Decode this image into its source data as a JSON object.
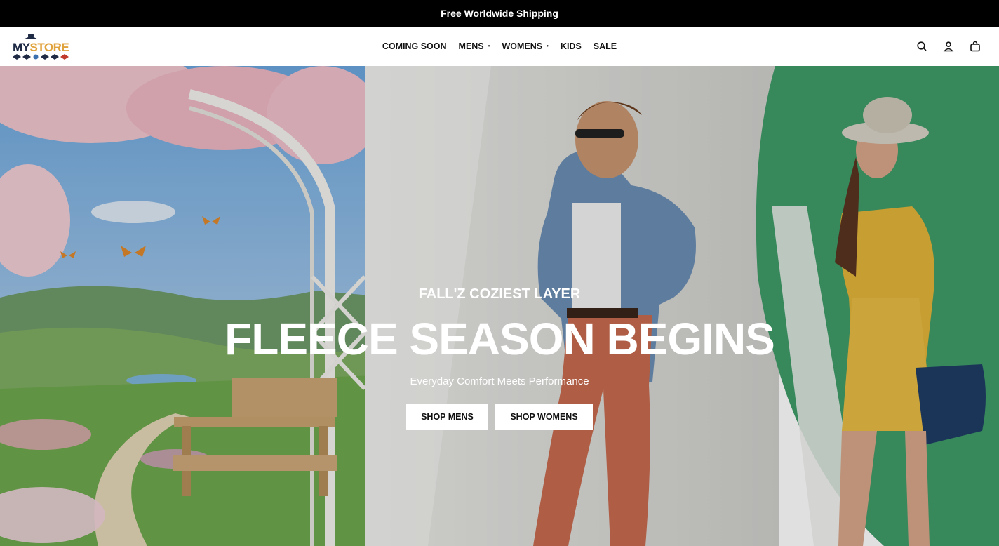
{
  "announcement": "Free Worldwide Shipping",
  "logo": {
    "part1": "MY",
    "part2": "STORE"
  },
  "nav": {
    "items": [
      {
        "label": "COMING SOON",
        "dropdown": false
      },
      {
        "label": "MENS",
        "dropdown": true
      },
      {
        "label": "WOMENS",
        "dropdown": true
      },
      {
        "label": "KIDS",
        "dropdown": false
      },
      {
        "label": "SALE",
        "dropdown": false
      }
    ],
    "caret": "•"
  },
  "header_icons": [
    "search-icon",
    "account-icon",
    "cart-icon"
  ],
  "hero": {
    "eyebrow": "FALL'Z COZIEST LAYER",
    "headline": "FLEECE SEASON BEGINS",
    "subtitle": "Everyday Comfort Meets Performance",
    "buttons": {
      "mens": "SHOP MENS",
      "womens": "SHOP WOMENS"
    }
  },
  "colors": {
    "announcement_bg": "#000000",
    "text_dark": "#111111",
    "accent_green": "#3f9b68",
    "logo_navy": "#1f2a44",
    "logo_gold": "#e0a23a"
  }
}
